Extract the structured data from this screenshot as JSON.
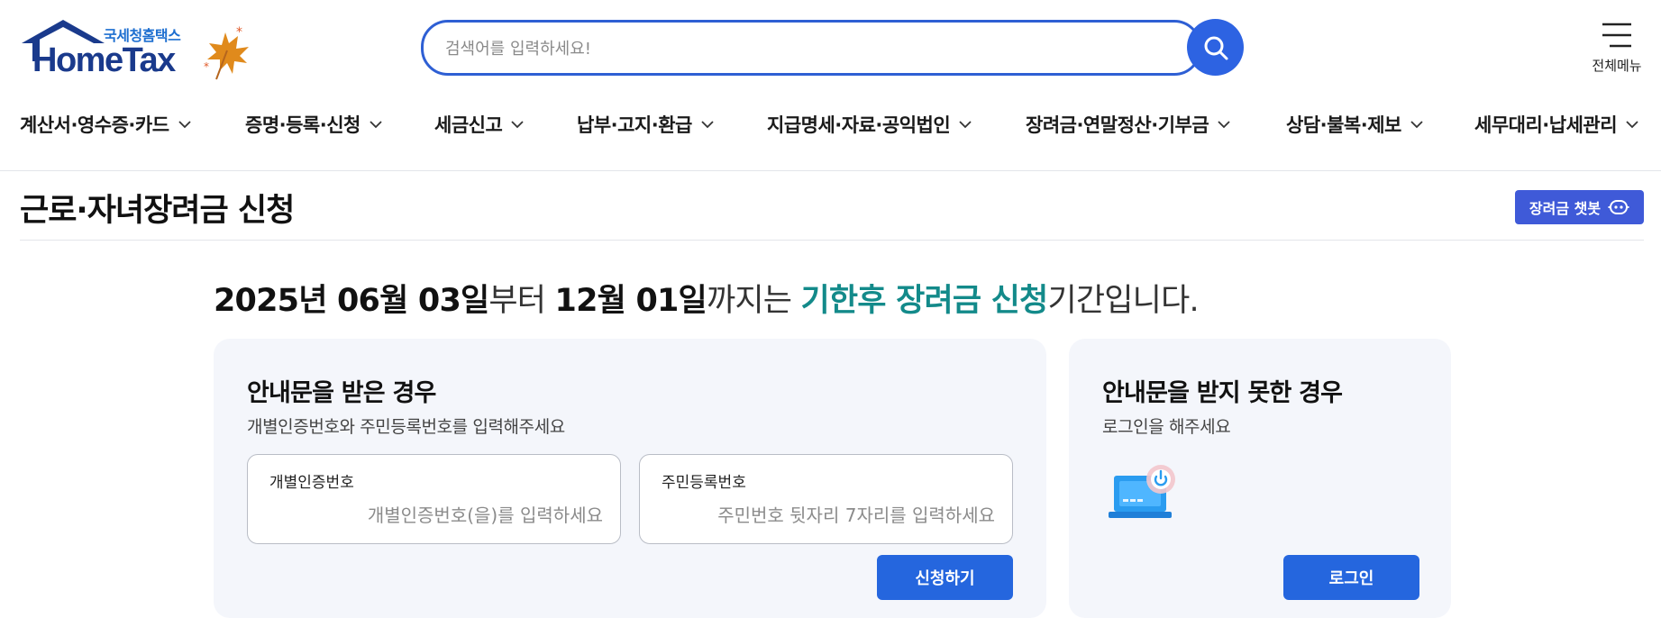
{
  "header": {
    "logo_kr": "국세청홈택스",
    "logo_en": "HomeTax",
    "search_placeholder": "검색어를 입력하세요!",
    "all_menu_label": "전체메뉴"
  },
  "gnb": {
    "items": [
      {
        "label": "계산서·영수증·카드"
      },
      {
        "label": "증명·등록·신청"
      },
      {
        "label": "세금신고"
      },
      {
        "label": "납부·고지·환급"
      },
      {
        "label": "지급명세·자료·공익법인"
      },
      {
        "label": "장려금·연말정산·기부금"
      },
      {
        "label": "상담·불복·제보"
      },
      {
        "label": "세무대리·납세관리"
      }
    ]
  },
  "page": {
    "title": "근로·자녀장려금 신청",
    "chatbot_label": "장려금 챗봇"
  },
  "period": {
    "start": "2025년 06월 03일",
    "from": "부터 ",
    "end": "12월 01일",
    "until": "까지는 ",
    "highlight": "기한후 장려금 신청",
    "tail": "기간입니다."
  },
  "card_notice": {
    "title": "안내문을 받은 경우",
    "subtitle": "개별인증번호와 주민등록번호를 입력해주세요",
    "field1_label": "개별인증번호",
    "field1_placeholder": "개별인증번호(을)를 입력하세요",
    "field2_label": "주민등록번호",
    "field2_placeholder": "주민번호 뒷자리 7자리를 입력하세요",
    "apply_label": "신청하기"
  },
  "card_login": {
    "title": "안내문을 받지 못한 경우",
    "subtitle": "로그인을 해주세요",
    "login_label": "로그인"
  },
  "colors": {
    "primary": "#2566de",
    "highlight": "#138a8a",
    "chatbot": "#3f5ad8",
    "card_bg": "#f4f6fb"
  }
}
